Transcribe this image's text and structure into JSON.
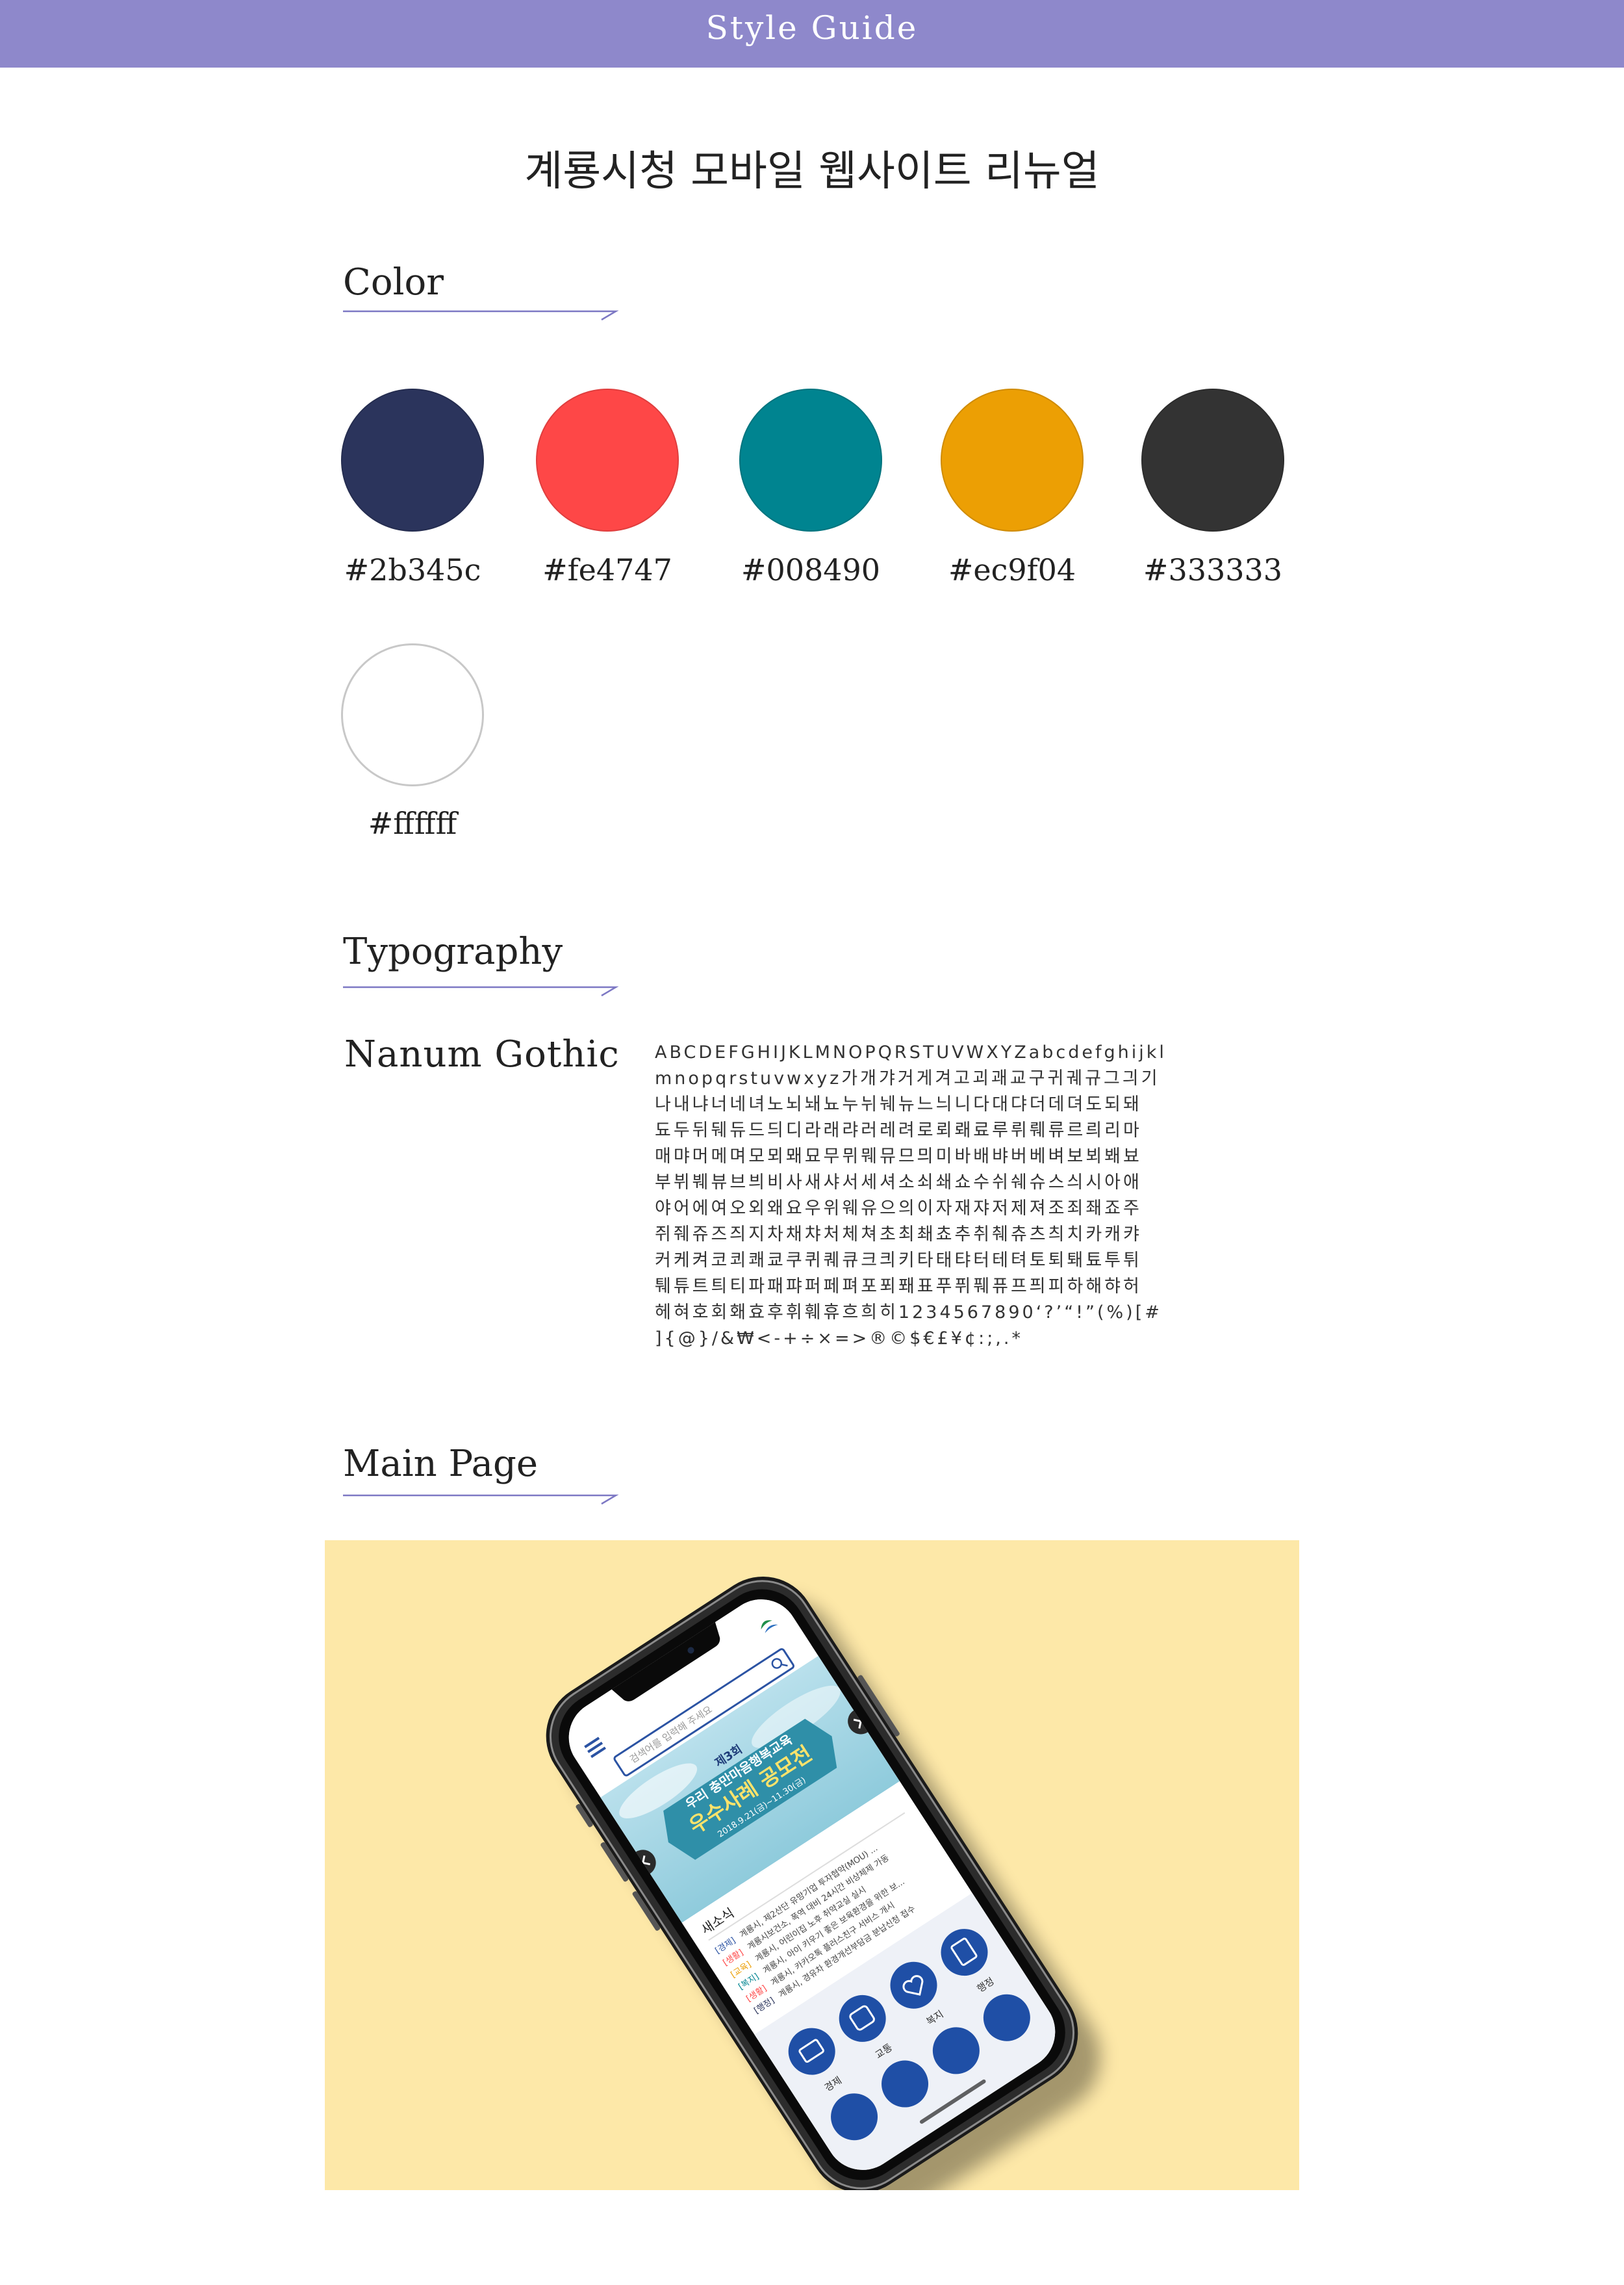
{
  "header": {
    "title": "Style Guide"
  },
  "page_title": "계룡시청 모바일 웹사이트 리뉴얼",
  "sections": {
    "color": "Color",
    "typography": "Typography",
    "main_page": "Main Page"
  },
  "colors": [
    {
      "code": "#2b345c",
      "hex": "#2b345c"
    },
    {
      "code": "#fe4747",
      "hex": "#fe4747"
    },
    {
      "code": "#008490",
      "hex": "#008490"
    },
    {
      "code": "#ec9f04",
      "hex": "#ec9f04"
    },
    {
      "code": "#333333",
      "hex": "#333333"
    },
    {
      "code": "#ffffff",
      "hex": "#ffffff"
    }
  ],
  "typography": {
    "font_name": "Nanum Gothic",
    "specimen": [
      "ABCDEFGHIJKLMNOPQRSTUVWXYZabcdefghijkl",
      "mnopqrstuvwxyz가개갸거게겨고괴괘교구귀궤규그긔기",
      "나내냐너네녀노뇌놰뇨누뉘눼뉴느늬니다대댜더데뎌도되돼",
      "됴두뒤뒈듀드듸디라래랴러레려로뢰뢔료루뤼뤠류르릐리마",
      "매먀머메며모뫼뫠묘무뮈뭬뮤므믜미바배뱌버베벼보뵈봬뵤",
      "부뷔붸뷰브븨비사새샤서세셔소쇠쇄쇼수쉬쉐슈스싀시아애",
      "야어에여오외왜요우위웨유으의이자재쟈저제져조죄좨죠주",
      "쥐줴쥬즈즤지차채챠처체쳐초최쵀쵸추취췌츄츠츼치카캐캬",
      "커케켜코쾨쾌쿄쿠퀴퀘큐크킈키타태탸터테텨토퇴퇘툐투튀",
      "퉤튜트틔티파패퍄퍼페펴포푀퐤표푸퓌풰퓨프픠피하해햐허",
      "헤혀호회홰효후휘훼휴흐희히1234567890‘?’“!”(%)[#",
      "]{@}/&₩<-+÷×=>®©$€£¥¢:;,.*"
    ]
  },
  "mockup": {
    "background": "#fde8a8",
    "search_placeholder": "검색어를 입력해 주세요",
    "banner_line1": "제3회",
    "banner_line2": "우리 충만마음행복교육",
    "banner_line3": "우수사례 공모전",
    "banner_date": "2018.9.21(금)~11.30(금)",
    "news_title": "새소식",
    "news_items": [
      {
        "tag": "[경제]",
        "text": "계룡시, 제2산단 유망기업 투자협약(MOU) ..."
      },
      {
        "tag": "[생활]",
        "text": "계룡시보건소, 폭역 대비 24시간 비상체제 가동"
      },
      {
        "tag": "[교육]",
        "text": "계룡시, 어린이집 노후 취약교실 실시"
      },
      {
        "tag": "[복지]",
        "text": "계룡시, 아이 키우기 좋은 보육환경을 위한 보..."
      },
      {
        "tag": "[생활]",
        "text": "계룡시, 카카오톡 플러스친구 서비스 개시"
      },
      {
        "tag": "[행정]",
        "text": "계룡시, 경유차 환경개선부담금 분납신청 접수"
      }
    ],
    "quick_menu": [
      "경제",
      "교통",
      "복지",
      "행정"
    ]
  }
}
